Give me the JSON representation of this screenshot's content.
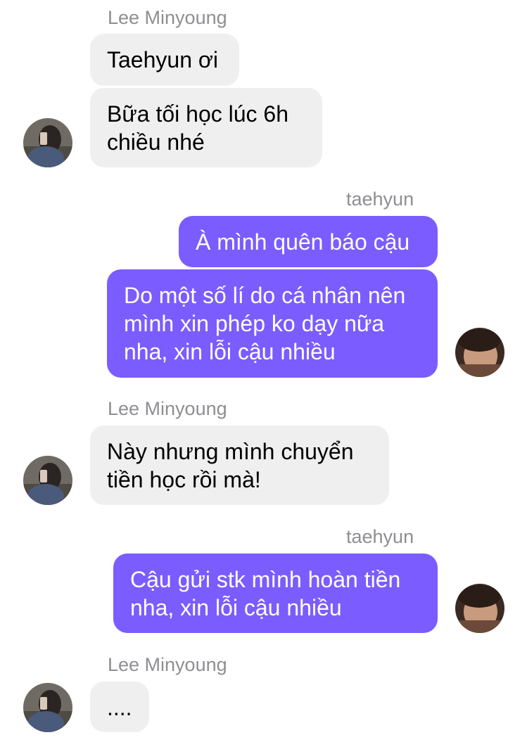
{
  "participants": {
    "other": {
      "name": "Lee Minyoung",
      "avatar_icon": "user-avatar-minyoung"
    },
    "self": {
      "name": "taehyun",
      "avatar_icon": "user-avatar-taehyun"
    }
  },
  "colors": {
    "incoming_bubble": "#efefef",
    "outgoing_bubble": "#7b5cff",
    "sender_name": "#8e8e93"
  },
  "messages": [
    {
      "sender": "Lee Minyoung",
      "bubbles": [
        "Taehyun ơi",
        "Bữa tối học lúc 6h\nchiều nhé"
      ]
    },
    {
      "sender": "taehyun",
      "bubbles": [
        "À mình quên báo cậu",
        "Do một số lí do cá nhân nên\nmình xin phép ko dạy nữa\nnha, xin lỗi cậu nhiều"
      ]
    },
    {
      "sender": "Lee Minyoung",
      "bubbles": [
        "Này nhưng mình chuyển\ntiền học rồi mà!"
      ]
    },
    {
      "sender": "taehyun",
      "bubbles": [
        "Cậu gửi stk mình hoàn tiền\nnha, xin lỗi cậu nhiều"
      ]
    },
    {
      "sender": "Lee Minyoung",
      "bubbles": [
        "...."
      ]
    }
  ]
}
